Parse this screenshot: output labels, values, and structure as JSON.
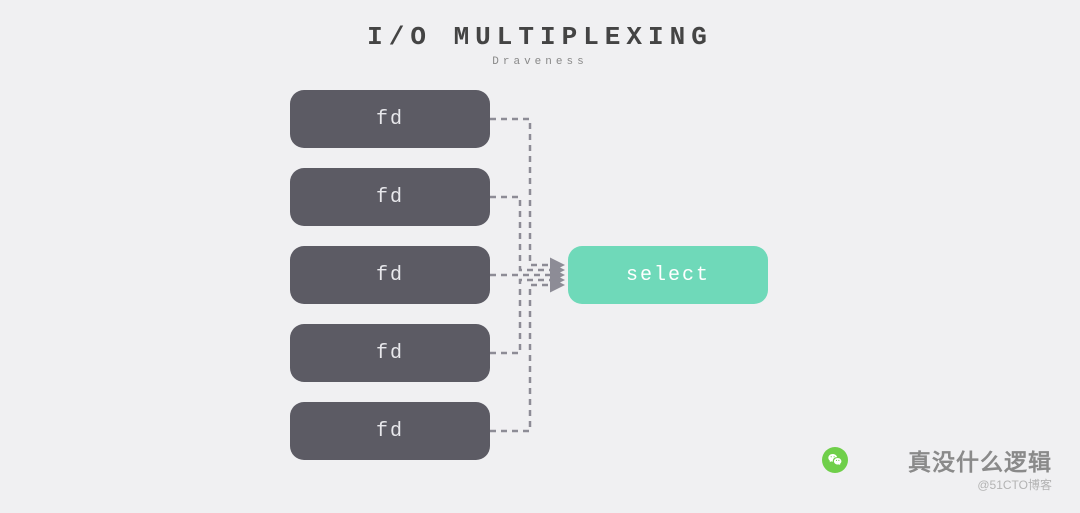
{
  "title": "I/O MULTIPLEXING",
  "subtitle": "Draveness",
  "fd_label": "fd",
  "select_label": "select",
  "watermark": {
    "text": "真没什么逻辑",
    "sub": "@51CTO博客"
  },
  "chart_data": {
    "type": "diagram",
    "title": "I/O Multiplexing",
    "author": "Draveness",
    "nodes": [
      {
        "id": "fd1",
        "label": "fd",
        "kind": "source"
      },
      {
        "id": "fd2",
        "label": "fd",
        "kind": "source"
      },
      {
        "id": "fd3",
        "label": "fd",
        "kind": "source"
      },
      {
        "id": "fd4",
        "label": "fd",
        "kind": "source"
      },
      {
        "id": "fd5",
        "label": "fd",
        "kind": "source"
      },
      {
        "id": "select",
        "label": "select",
        "kind": "target"
      }
    ],
    "edges": [
      {
        "from": "fd1",
        "to": "select",
        "style": "dashed-arrow"
      },
      {
        "from": "fd2",
        "to": "select",
        "style": "dashed-arrow"
      },
      {
        "from": "fd3",
        "to": "select",
        "style": "dashed-arrow"
      },
      {
        "from": "fd4",
        "to": "select",
        "style": "dashed-arrow"
      },
      {
        "from": "fd5",
        "to": "select",
        "style": "dashed-arrow"
      }
    ]
  }
}
